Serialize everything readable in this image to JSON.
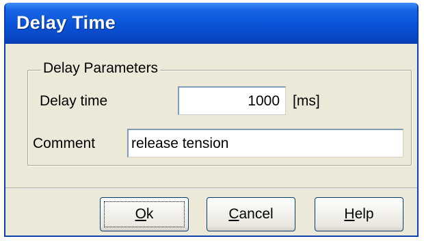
{
  "window": {
    "title": "Delay Time"
  },
  "group": {
    "legend": "Delay Parameters",
    "delay_label": "Delay time",
    "delay_value": "1000",
    "delay_unit": "[ms]"
  },
  "comment": {
    "label": "Comment",
    "value": "release tension"
  },
  "buttons": {
    "ok": {
      "accel": "O",
      "rest": "k"
    },
    "cancel": {
      "accel": "C",
      "rest": "ancel"
    },
    "help": {
      "accel": "H",
      "rest": "elp"
    }
  }
}
